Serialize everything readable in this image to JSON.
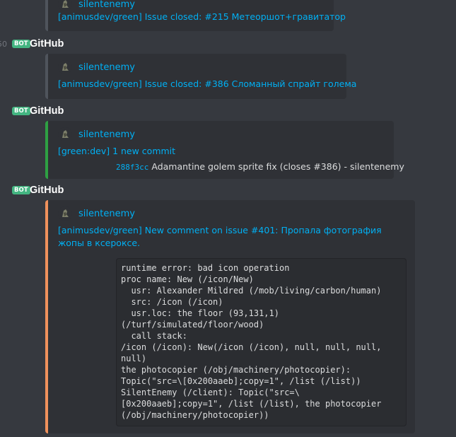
{
  "messages": [
    {
      "embed_author": "silentenemy",
      "embed_title": "[animusdev/green] Issue closed: #215 Метеоршот+гравитатор"
    },
    {
      "timestamp": "50",
      "bot_tag": "BOT",
      "author": "GitHub",
      "embed_author": "silentenemy",
      "embed_title": "[animusdev/green] Issue closed: #386 Сломанный спрайт голема"
    },
    {
      "bot_tag": "BOT",
      "author": "GitHub",
      "embed_author": "silentenemy",
      "embed_title": "[green:dev] 1 new commit",
      "commit_hash": "288f3cc",
      "commit_text": "Adamantine golem sprite fix (closes #386) - silentenemy"
    },
    {
      "bot_tag": "BOT",
      "author": "GitHub",
      "embed_author": "silentenemy",
      "embed_title": "[animusdev/green] New comment on issue #401: Пропала фотография жопы в ксероксе.",
      "code": "runtime error: bad icon operation\nproc name: New (/icon/New)\n  usr: Alexander Mildred (/mob/living/carbon/human)\n  src: /icon (/icon)\n  usr.loc: the floor (93,131,1)\n(/turf/simulated/floor/wood)\n  call stack:\n/icon (/icon): New(/icon (/icon), null, null, null,\nnull)\nthe photocopier (/obj/machinery/photocopier):\nTopic(\"src=\\[0x200aaeb];copy=1\", /list (/list))\nSilentEnemy (/client): Topic(\"src=\\\n[0x200aaeb];copy=1\", /list (/list), the photocopier\n(/obj/machinery/photocopier))"
    }
  ],
  "colors": {
    "background": "#36393f",
    "embed_bg": "#2f3136",
    "link": "#00b0f4",
    "bot_tag": "#43b581",
    "bar_grey": "#4f545c",
    "bar_green": "#2ea043",
    "bar_orange": "#f0915c"
  },
  "icons": {
    "avatar": "avatar-icon"
  }
}
